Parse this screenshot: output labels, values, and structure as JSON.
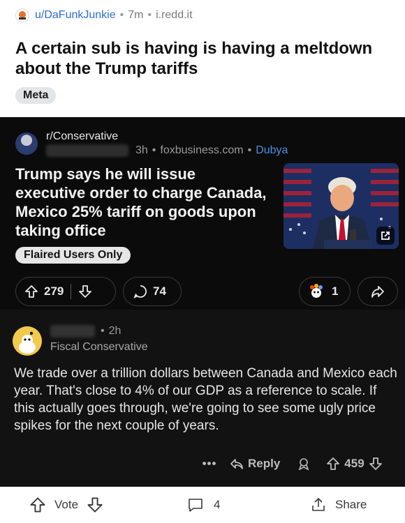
{
  "post": {
    "username": "u/DaFunkJunkie",
    "age": "7m",
    "domain": "i.redd.it",
    "title": "A certain sub is having is having a meltdown about the Trump tariffs",
    "flair": "Meta"
  },
  "crosspost": {
    "subreddit": "r/Conservative",
    "age": "3h",
    "domain": "foxbusiness.com",
    "user_flair": "Dubya",
    "title": "Trump says he will issue executive order to charge Canada, Mexico 25% tariff on goods upon taking office",
    "flair": "Flaired Users Only",
    "upvotes": "279",
    "comments": "74",
    "awards": "1"
  },
  "comment": {
    "age": "2h",
    "flair": "Fiscal Conservative",
    "body": "We trade over a trillion dollars between Canada and Mexico each year. That's close to 4% of our GDP as a reference to scale. If this actually goes through, we're going to see some ugly price spikes for the next couple of years.",
    "more": "•••",
    "reply_label": "Reply",
    "score": "459"
  },
  "bottom_bar": {
    "vote_label": "Vote",
    "comments_count": "4",
    "share_label": "Share"
  },
  "colors": {
    "username": "#2a6fd6",
    "dark_bg": "#121212",
    "link_blue": "#4a8fe0"
  }
}
